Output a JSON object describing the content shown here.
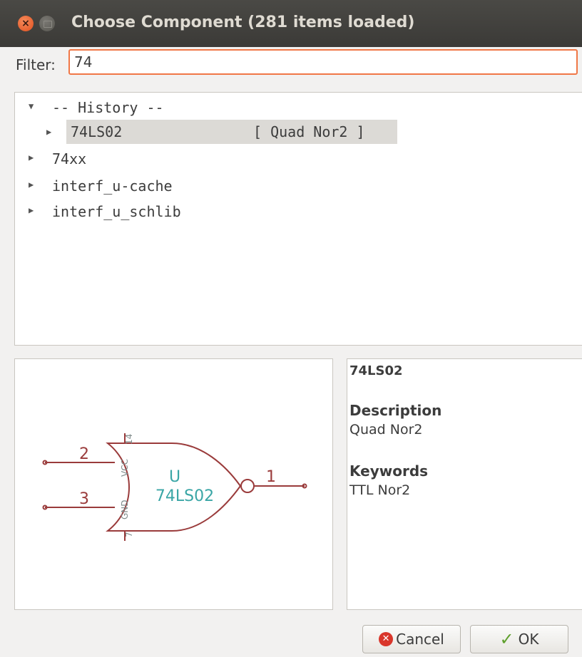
{
  "window": {
    "title": "Choose Component (281 items loaded)",
    "close_glyph": "×"
  },
  "filter": {
    "label": "Filter:",
    "value": "74"
  },
  "tree": {
    "history_label": "-- History --",
    "history_item": {
      "name": "74LS02",
      "description": "[ Quad Nor2 ]"
    },
    "libraries": [
      "74xx",
      "interf_u-cache",
      "interf_u_schlib"
    ]
  },
  "symbol": {
    "ref": "U",
    "value": "74LS02",
    "pin_in_1": "2",
    "pin_in_2": "3",
    "pin_out": "1",
    "vcc_label": "VCC",
    "vcc_pin": "14",
    "gnd_label": "GND",
    "gnd_pin": "7",
    "line_color": "#9a3b3b",
    "text_color": "#3aa6a6"
  },
  "info": {
    "name": "74LS02",
    "description_header": "Description",
    "description": "Quad Nor2",
    "keywords_header": "Keywords",
    "keywords": "TTL Nor2"
  },
  "buttons": {
    "cancel": "Cancel",
    "ok": "OK"
  },
  "colors": {
    "accent": "#f07746",
    "titlebar": "#3e3d39"
  }
}
